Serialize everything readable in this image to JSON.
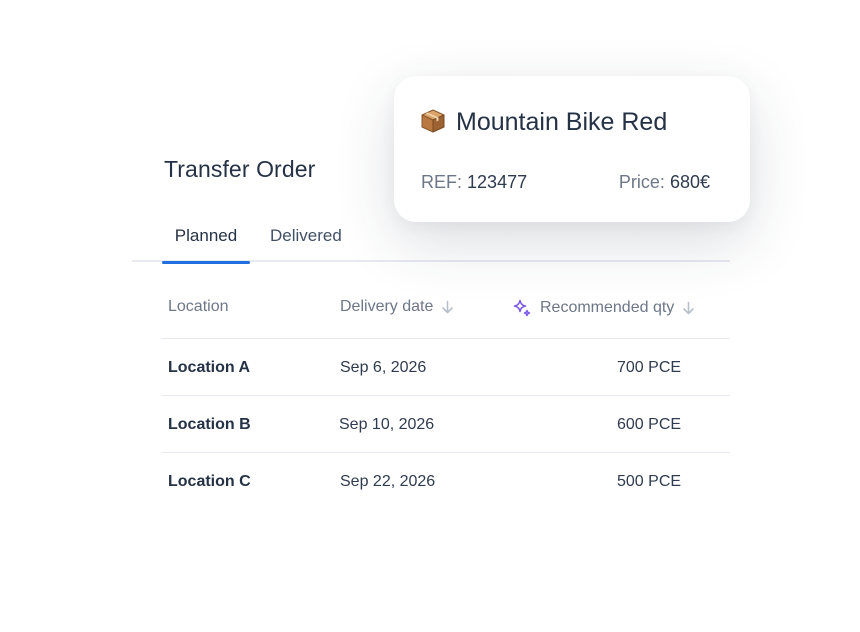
{
  "page": {
    "title": "Transfer Order"
  },
  "tabs": [
    {
      "label": "Planned",
      "active": true
    },
    {
      "label": "Delivered",
      "active": false
    }
  ],
  "table": {
    "columns": {
      "location": "Location",
      "delivery_date": "Delivery date",
      "recommended_qty": "Recommended qty"
    },
    "rows": [
      {
        "location": "Location A",
        "delivery_date": "Sep 6, 2026",
        "qty": "700 PCE"
      },
      {
        "location": "Location B",
        "delivery_date": "Sep 10, 2026",
        "qty": "600 PCE"
      },
      {
        "location": "Location C",
        "delivery_date": "Sep 22, 2026",
        "qty": "500 PCE"
      }
    ]
  },
  "product_card": {
    "icon": "package-icon",
    "name": "Mountain Bike Red",
    "ref_label": "REF:",
    "ref_value": "123477",
    "price_label": "Price:",
    "price_value": "680€"
  },
  "colors": {
    "accent": "#1f6fe0",
    "sparkle": "#7b5ce6",
    "text": "#253245",
    "muted": "#6d7788"
  }
}
